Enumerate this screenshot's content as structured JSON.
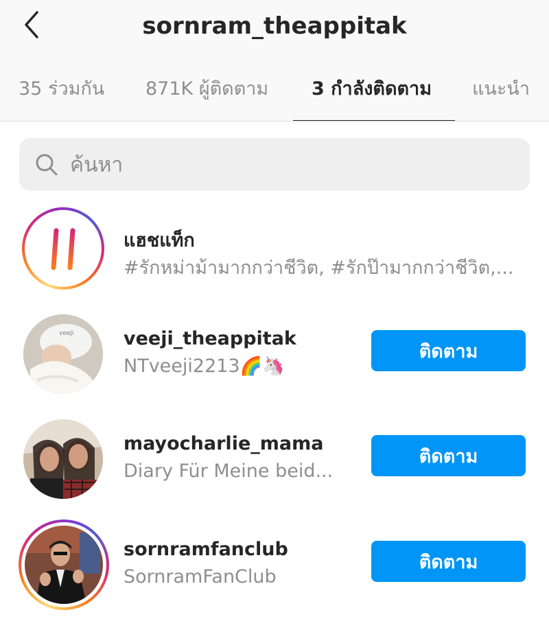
{
  "header": {
    "title": "sornram_theappitak",
    "back_icon": "chevron-left-icon"
  },
  "tabs": [
    {
      "label": "35 ร่วมกัน",
      "active": false
    },
    {
      "label": "871K ผู้ติดตาม",
      "active": false
    },
    {
      "label": "3 กำลังติดตาม",
      "active": true
    },
    {
      "label": "แนะนำ",
      "active": false
    }
  ],
  "search": {
    "placeholder": "ค้นหา",
    "value": ""
  },
  "list": [
    {
      "kind": "hashtag",
      "name": "แฮชแท็ก",
      "subtitle": "#รักหม่าม้ามากกว่าชีวิต, #รักป๊ามากกว่าชีวิต,..."
    },
    {
      "kind": "account",
      "name": "veeji_theappitak",
      "subtitle": "NTveeji2213",
      "subtitle_emoji": "🌈🦄",
      "button": "ติดตาม"
    },
    {
      "kind": "account",
      "name": "mayocharlie_mama",
      "subtitle": "Diary Für Meine beid...",
      "button": "ติดตาม"
    },
    {
      "kind": "account",
      "name": "sornramfanclub",
      "subtitle": "SornramFanClub",
      "button": "ติดตาม",
      "story_ring": true
    }
  ],
  "colors": {
    "accent": "#0095f6",
    "text_primary": "#262626",
    "text_secondary": "#8e8e8e",
    "search_bg": "#efefef",
    "header_bg": "#f9f9f9"
  }
}
